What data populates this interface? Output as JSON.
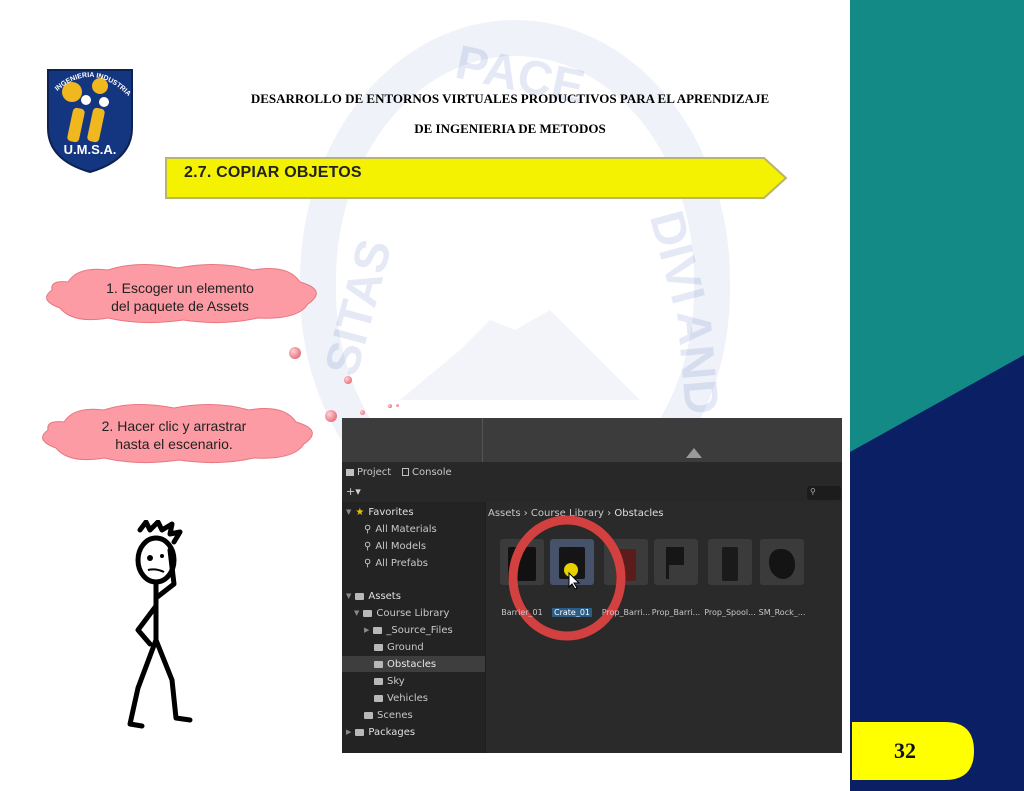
{
  "header": {
    "line1": "DESARROLLO DE ENTORNOS VIRTUALES PRODUCTIVOS PARA EL APRENDIZAJE",
    "line2": "DE INGENIERIA DE METODOS"
  },
  "logo": {
    "arc_text": "INGENIERIA INDUSTRIAL",
    "acronym": "U.M.S.A."
  },
  "watermark": {
    "words": [
      "PACE",
      "SITAS",
      "DIVI",
      "AND"
    ]
  },
  "section": {
    "title": "2.7. COPIAR OBJETOS"
  },
  "steps": [
    {
      "line1": "1. Escoger un elemento",
      "line2": "del paquete de Assets"
    },
    {
      "line1": "2. Hacer clic y arrastrar",
      "line2": "hasta el escenario."
    }
  ],
  "unity": {
    "tabs": [
      "Project",
      "Console"
    ],
    "add_label": "+▾",
    "favorites": {
      "label": "Favorites",
      "items": [
        "All Materials",
        "All Models",
        "All Prefabs"
      ]
    },
    "assets": {
      "label": "Assets",
      "course_library": "Course Library",
      "children": [
        "_Source_Files",
        "Ground",
        "Obstacles",
        "Sky",
        "Vehicles"
      ],
      "scenes": "Scenes"
    },
    "packages": "Packages",
    "breadcrumb": [
      "Assets",
      "Course Library",
      "Obstacles"
    ],
    "asset_items": [
      "Barrier_01",
      "Crate_01",
      "Prop_Barri...",
      "Prop_Barri...",
      "Prop_Spool...",
      "SM_Rock_..."
    ],
    "selected_asset": "Crate_01"
  },
  "page_number": "32",
  "colors": {
    "teal": "#148a86",
    "navy": "#0b2064",
    "banner_yellow": "#f4f200",
    "cloud_pink": "#fd9ba4",
    "highlight_ring": "#d2403f",
    "page_yellow": "#ffff00"
  }
}
